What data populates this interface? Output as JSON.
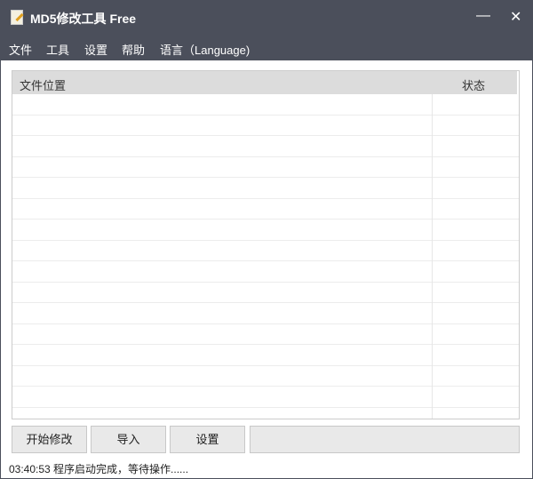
{
  "window": {
    "title": "MD5修改工具 Free",
    "minimize": "—",
    "close": "✕"
  },
  "menu": [
    "文件",
    "工具",
    "设置",
    "帮助",
    "语言（Language)"
  ],
  "table": {
    "columns": [
      "文件位置",
      "状态"
    ],
    "row_count": 15
  },
  "buttons": {
    "start": "开始修改",
    "import": "导入",
    "settings": "设置"
  },
  "status": "03:40:53 程序启动完成，等待操作......"
}
